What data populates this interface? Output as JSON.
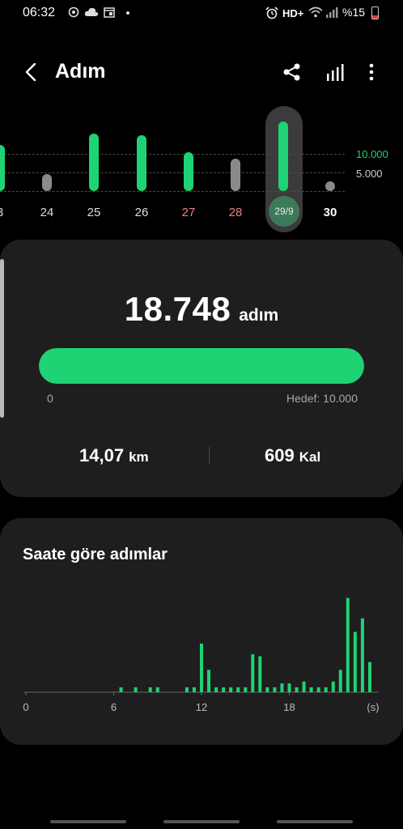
{
  "status_bar": {
    "time": "06:32",
    "network_label": "HD+",
    "battery_text": "%15",
    "left_icons": [
      "sync-icon",
      "cloud-icon",
      "calendar-icon",
      "dot-icon"
    ],
    "right_icons": [
      "alarm-icon",
      "wifi-icon",
      "signal-icon",
      "battery-icon"
    ]
  },
  "header": {
    "title": "Adım",
    "actions": [
      "share-icon",
      "stats-icon",
      "more-icon"
    ]
  },
  "week_chart": {
    "goal_line_label": "10.000",
    "half_line_label": "5.000",
    "goal_color": "#1ed373",
    "days": [
      {
        "label": "3",
        "steps": 12500,
        "met": true
      },
      {
        "label": "24",
        "steps": 4500,
        "met": false
      },
      {
        "label": "25",
        "steps": 15500,
        "met": true
      },
      {
        "label": "26",
        "steps": 15000,
        "met": true
      },
      {
        "label": "27",
        "steps": 10500,
        "met": true,
        "weekend": true
      },
      {
        "label": "28",
        "steps": 8800,
        "met": false,
        "weekend": true
      },
      {
        "label": "29/9",
        "steps": 18748,
        "met": true,
        "selected": true
      },
      {
        "label": "30",
        "steps": 0,
        "met": false
      }
    ]
  },
  "summary": {
    "steps_value": "18.748",
    "steps_unit": "adım",
    "progress_min": "0",
    "progress_goal": "Hedef: 10.000",
    "progress_fraction": 1.0,
    "distance_value": "14,07",
    "distance_unit": "km",
    "calories_value": "609",
    "calories_unit": "Kal"
  },
  "hourly": {
    "title": "Saate göre adımlar",
    "x_labels": [
      "0",
      "6",
      "12",
      "18",
      "(s)"
    ]
  },
  "chart_data": {
    "type": "bar",
    "title": "Saate göre adımlar",
    "xlabel": "(s)",
    "ylabel": "",
    "x_ticks": [
      0,
      6,
      12,
      18
    ],
    "xlim": [
      0,
      24
    ],
    "ylim": [
      0,
      100
    ],
    "x": [
      6.5,
      7.5,
      8.5,
      9.0,
      11.0,
      11.5,
      12.0,
      12.5,
      13.0,
      13.5,
      14.0,
      14.5,
      15.0,
      15.5,
      16.0,
      16.5,
      17.0,
      17.5,
      18.0,
      18.5,
      19.0,
      19.5,
      20.0,
      20.5,
      21.0,
      21.5,
      22.0,
      22.5,
      23.0,
      23.5
    ],
    "values": [
      5,
      5,
      5,
      5,
      5,
      5,
      50,
      23,
      5,
      5,
      5,
      5,
      5,
      39,
      37,
      5,
      5,
      9,
      9,
      5,
      11,
      5,
      5,
      5,
      11,
      23,
      97,
      62,
      76,
      31
    ]
  }
}
